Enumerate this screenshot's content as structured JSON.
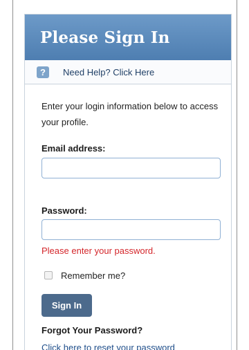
{
  "header": {
    "title": "Please Sign In"
  },
  "help": {
    "icon": "question-icon",
    "icon_glyph": "?",
    "link_text": "Need Help? Click Here"
  },
  "intro_text": "Enter your login information below to access your profile.",
  "form": {
    "email": {
      "label": "Email address:",
      "value": ""
    },
    "password": {
      "label": "Password:",
      "value": "",
      "error": "Please enter your password."
    },
    "remember": {
      "label": "Remember me?",
      "checked": false
    },
    "submit_label": "Sign In"
  },
  "forgot": {
    "title": "Forgot Your Password?",
    "link_text": "Click here to reset your password"
  },
  "colors": {
    "header_gradient_top": "#6d9ac8",
    "header_gradient_bottom": "#4e7eb1",
    "button": "#4c6a8c",
    "error": "#d4262b",
    "link": "#1f4e8a",
    "input_border": "#8fb0d4"
  }
}
